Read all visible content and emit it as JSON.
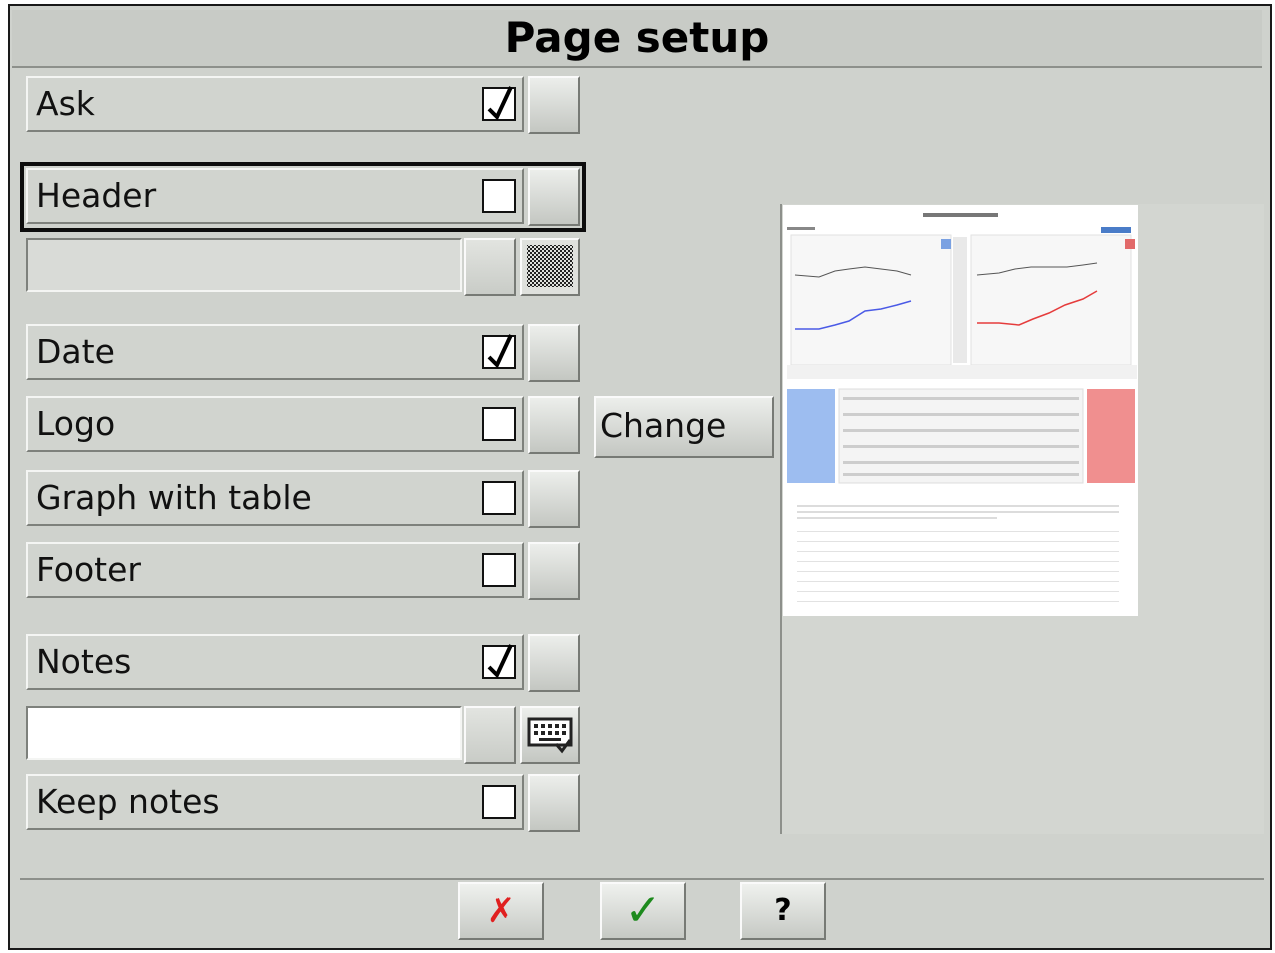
{
  "dialog": {
    "title": "Page setup"
  },
  "options": [
    {
      "label": "Ask",
      "checked": true
    },
    {
      "label": "Header",
      "checked": false
    },
    {
      "label": "Date",
      "checked": true
    },
    {
      "label": "Logo",
      "checked": false
    },
    {
      "label": "Graph with table",
      "checked": false
    },
    {
      "label": "Footer",
      "checked": false
    },
    {
      "label": "Notes",
      "checked": true
    },
    {
      "label": "Keep notes",
      "checked": false
    }
  ],
  "header_field": {
    "value": "",
    "icon": "pattern-icon"
  },
  "notes_field": {
    "value": "",
    "icon": "keyboard-icon"
  },
  "logo": {
    "change_label": "Change"
  },
  "footer_buttons": {
    "cancel_glyph": "✗",
    "ok_glyph": "✓",
    "help_label": "?",
    "cancel_color": "#e02020",
    "ok_color": "#1d8a1d"
  }
}
